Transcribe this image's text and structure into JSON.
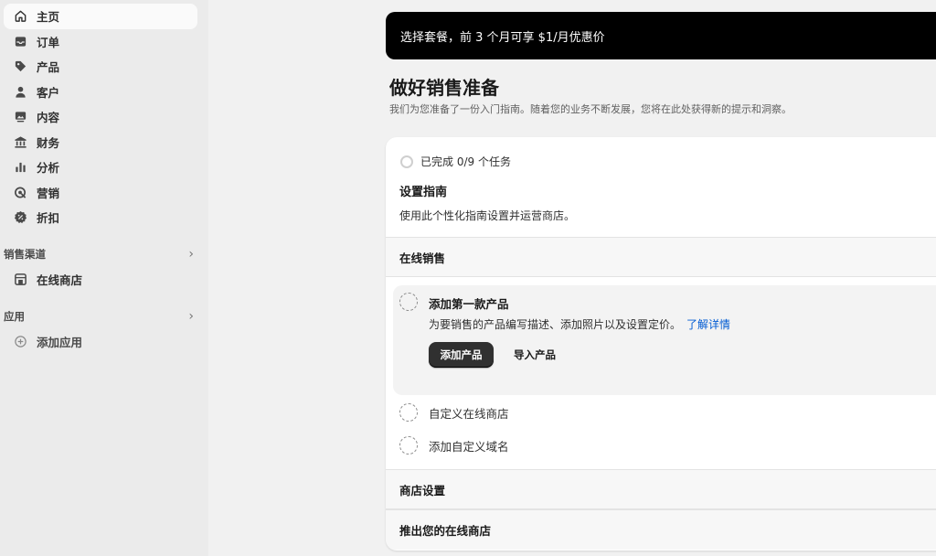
{
  "sidebar": {
    "nav": [
      {
        "label": "主页",
        "icon": "home-icon",
        "active": true
      },
      {
        "label": "订单",
        "icon": "inbox-icon"
      },
      {
        "label": "产品",
        "icon": "tag-icon"
      },
      {
        "label": "客户",
        "icon": "person-icon"
      },
      {
        "label": "内容",
        "icon": "image-icon"
      },
      {
        "label": "财务",
        "icon": "bank-icon"
      },
      {
        "label": "分析",
        "icon": "bar-chart-icon"
      },
      {
        "label": "营销",
        "icon": "target-icon"
      },
      {
        "label": "折扣",
        "icon": "discount-icon"
      }
    ],
    "sales_channels": {
      "heading": "销售渠道",
      "items": [
        {
          "label": "在线商店",
          "icon": "store-icon"
        }
      ]
    },
    "apps": {
      "heading": "应用",
      "items": [
        {
          "label": "添加应用",
          "icon": "plus-circle-icon"
        }
      ]
    }
  },
  "banner": {
    "text": "选择套餐，前 3 个月可享 $1/月优惠价"
  },
  "page": {
    "title": "做好销售准备",
    "subtitle": "我们为您准备了一份入门指南。随着您的业务不断发展，您将在此处获得新的提示和洞察。"
  },
  "guide": {
    "progress": "已完成 0/9 个任务",
    "title": "设置指南",
    "description": "使用此个性化指南设置并运营商店。",
    "sections": {
      "online_sales": "在线销售",
      "store_settings": "商店设置",
      "launch": "推出您的在线商店"
    },
    "active_task": {
      "title": "添加第一款产品",
      "description": "为要销售的产品编写描述、添加照片以及设置定价。",
      "link": "了解详情",
      "primary_button": "添加产品",
      "secondary_button": "导入产品"
    },
    "tasks": [
      "自定义在线商店",
      "添加自定义域名"
    ]
  }
}
